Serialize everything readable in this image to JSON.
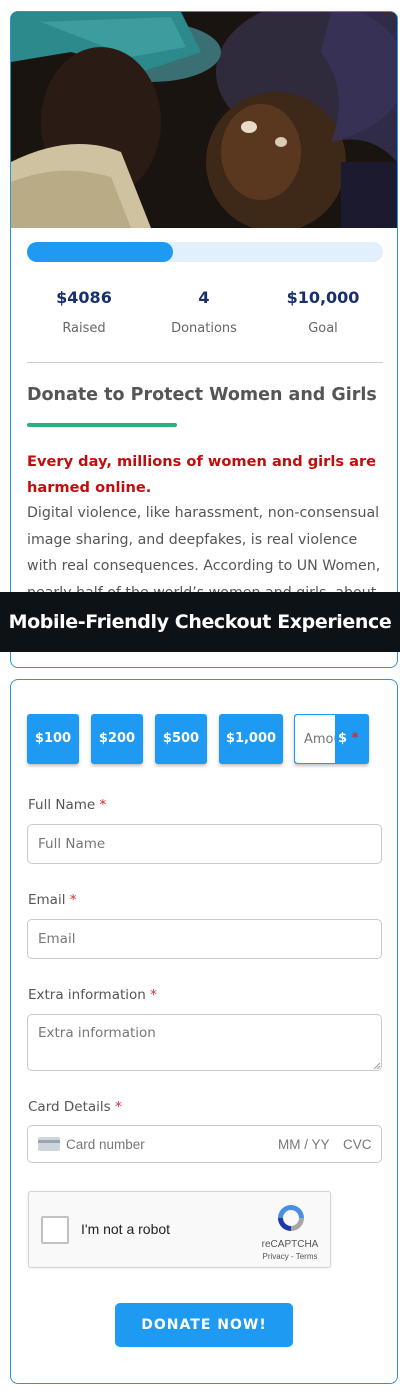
{
  "campaign": {
    "progress_fraction": 0.41,
    "stats": [
      {
        "value": "$4086",
        "label": "Raised"
      },
      {
        "value": "4",
        "label": "Donations"
      },
      {
        "value": "$10,000",
        "label": "Goal"
      }
    ],
    "title": "Donate to Protect Women and Girls",
    "lead": "Every day, millions of women and girls are harmed online.",
    "body": "Digital violence, like harassment, non-consensual image sharing, and deepfakes, is real violence with real consequences. According to UN Women, nearly half of the world’s women and girls, about",
    "colors": {
      "accent": "#1e9af2",
      "lead": "#c20d0d",
      "underline": "#2bb07f",
      "stat": "#1a2f6e"
    }
  },
  "banner": {
    "text": "Mobile-Friendly Checkout Experience"
  },
  "form": {
    "amounts": [
      "$100",
      "$200",
      "$500",
      "$1,000"
    ],
    "custom_amount": {
      "placeholder": "Amount",
      "currency": "$",
      "required_mark": "*"
    },
    "fields": {
      "full_name": {
        "label": "Full Name",
        "placeholder": "Full Name",
        "required_mark": "*"
      },
      "email": {
        "label": "Email",
        "placeholder": "Email",
        "required_mark": "*"
      },
      "extra": {
        "label": "Extra information",
        "placeholder": "Extra information",
        "required_mark": "*"
      },
      "card": {
        "label": "Card Details",
        "required_mark": "*",
        "number_placeholder": "Card number",
        "expiry_placeholder": "MM / YY",
        "cvc_placeholder": "CVC"
      }
    },
    "recaptcha": {
      "label": "I'm not a robot",
      "brand": "reCAPTCHA",
      "links": "Privacy - Terms"
    },
    "submit_label": "DONATE NOW!"
  }
}
